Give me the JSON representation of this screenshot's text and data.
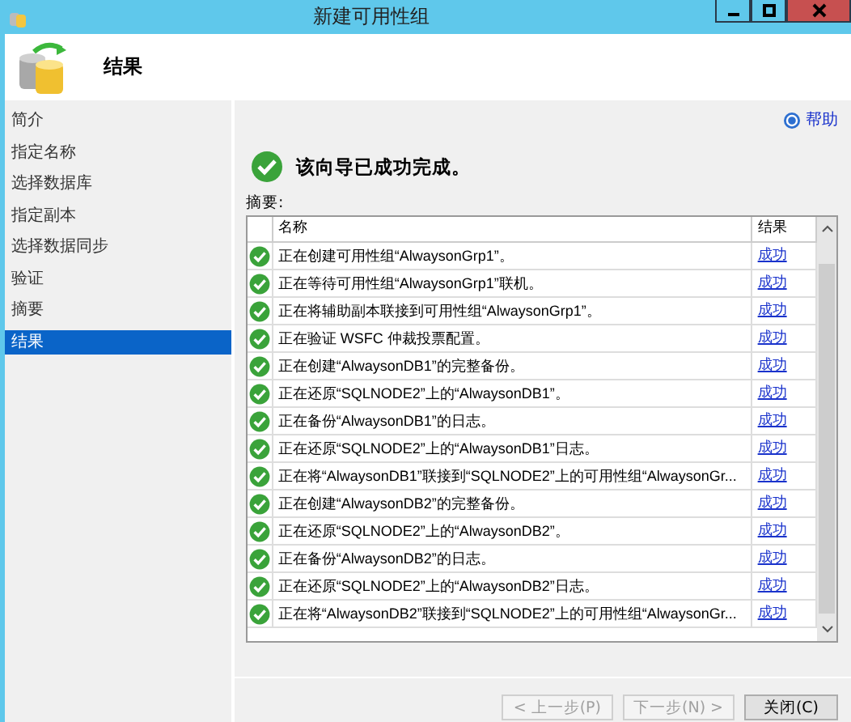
{
  "window": {
    "title": "新建可用性组"
  },
  "header": {
    "title": "结果"
  },
  "sidebar": {
    "items": [
      {
        "label": "简介",
        "selected": false
      },
      {
        "label": "指定名称",
        "selected": false
      },
      {
        "label": "选择数据库",
        "selected": false
      },
      {
        "label": "指定副本",
        "selected": false
      },
      {
        "label": "选择数据同步",
        "selected": false
      },
      {
        "label": "验证",
        "selected": false
      },
      {
        "label": "摘要",
        "selected": false
      },
      {
        "label": "结果",
        "selected": true
      }
    ]
  },
  "help": "帮助",
  "status_message": "该向导已成功完成。",
  "summary_label": "摘要:",
  "table": {
    "columns": [
      "名称",
      "结果"
    ],
    "rows": [
      {
        "name": "正在创建可用性组“AlwaysonGrp1”。",
        "result": "成功"
      },
      {
        "name": "正在等待可用性组“AlwaysonGrp1”联机。",
        "result": "成功"
      },
      {
        "name": "正在将辅助副本联接到可用性组“AlwaysonGrp1”。",
        "result": "成功"
      },
      {
        "name": "正在验证 WSFC 仲裁投票配置。",
        "result": "成功"
      },
      {
        "name": "正在创建“AlwaysonDB1”的完整备份。",
        "result": "成功"
      },
      {
        "name": "正在还原“SQLNODE2”上的“AlwaysonDB1”。",
        "result": "成功"
      },
      {
        "name": "正在备份“AlwaysonDB1”的日志。",
        "result": "成功"
      },
      {
        "name": "正在还原“SQLNODE2”上的“AlwaysonDB1”日志。",
        "result": "成功"
      },
      {
        "name": "正在将“AlwaysonDB1”联接到“SQLNODE2”上的可用性组“AlwaysonGr...",
        "result": "成功"
      },
      {
        "name": "正在创建“AlwaysonDB2”的完整备份。",
        "result": "成功"
      },
      {
        "name": "正在还原“SQLNODE2”上的“AlwaysonDB2”。",
        "result": "成功"
      },
      {
        "name": "正在备份“AlwaysonDB2”的日志。",
        "result": "成功"
      },
      {
        "name": "正在还原“SQLNODE2”上的“AlwaysonDB2”日志。",
        "result": "成功"
      },
      {
        "name": "正在将“AlwaysonDB2”联接到“SQLNODE2”上的可用性组“AlwaysonGr...",
        "result": "成功"
      }
    ]
  },
  "buttons": [
    {
      "label": "< 上一步(P)",
      "disabled": true
    },
    {
      "label": "下一步(N) >",
      "disabled": true
    },
    {
      "label": "关闭(C)",
      "disabled": false
    }
  ]
}
